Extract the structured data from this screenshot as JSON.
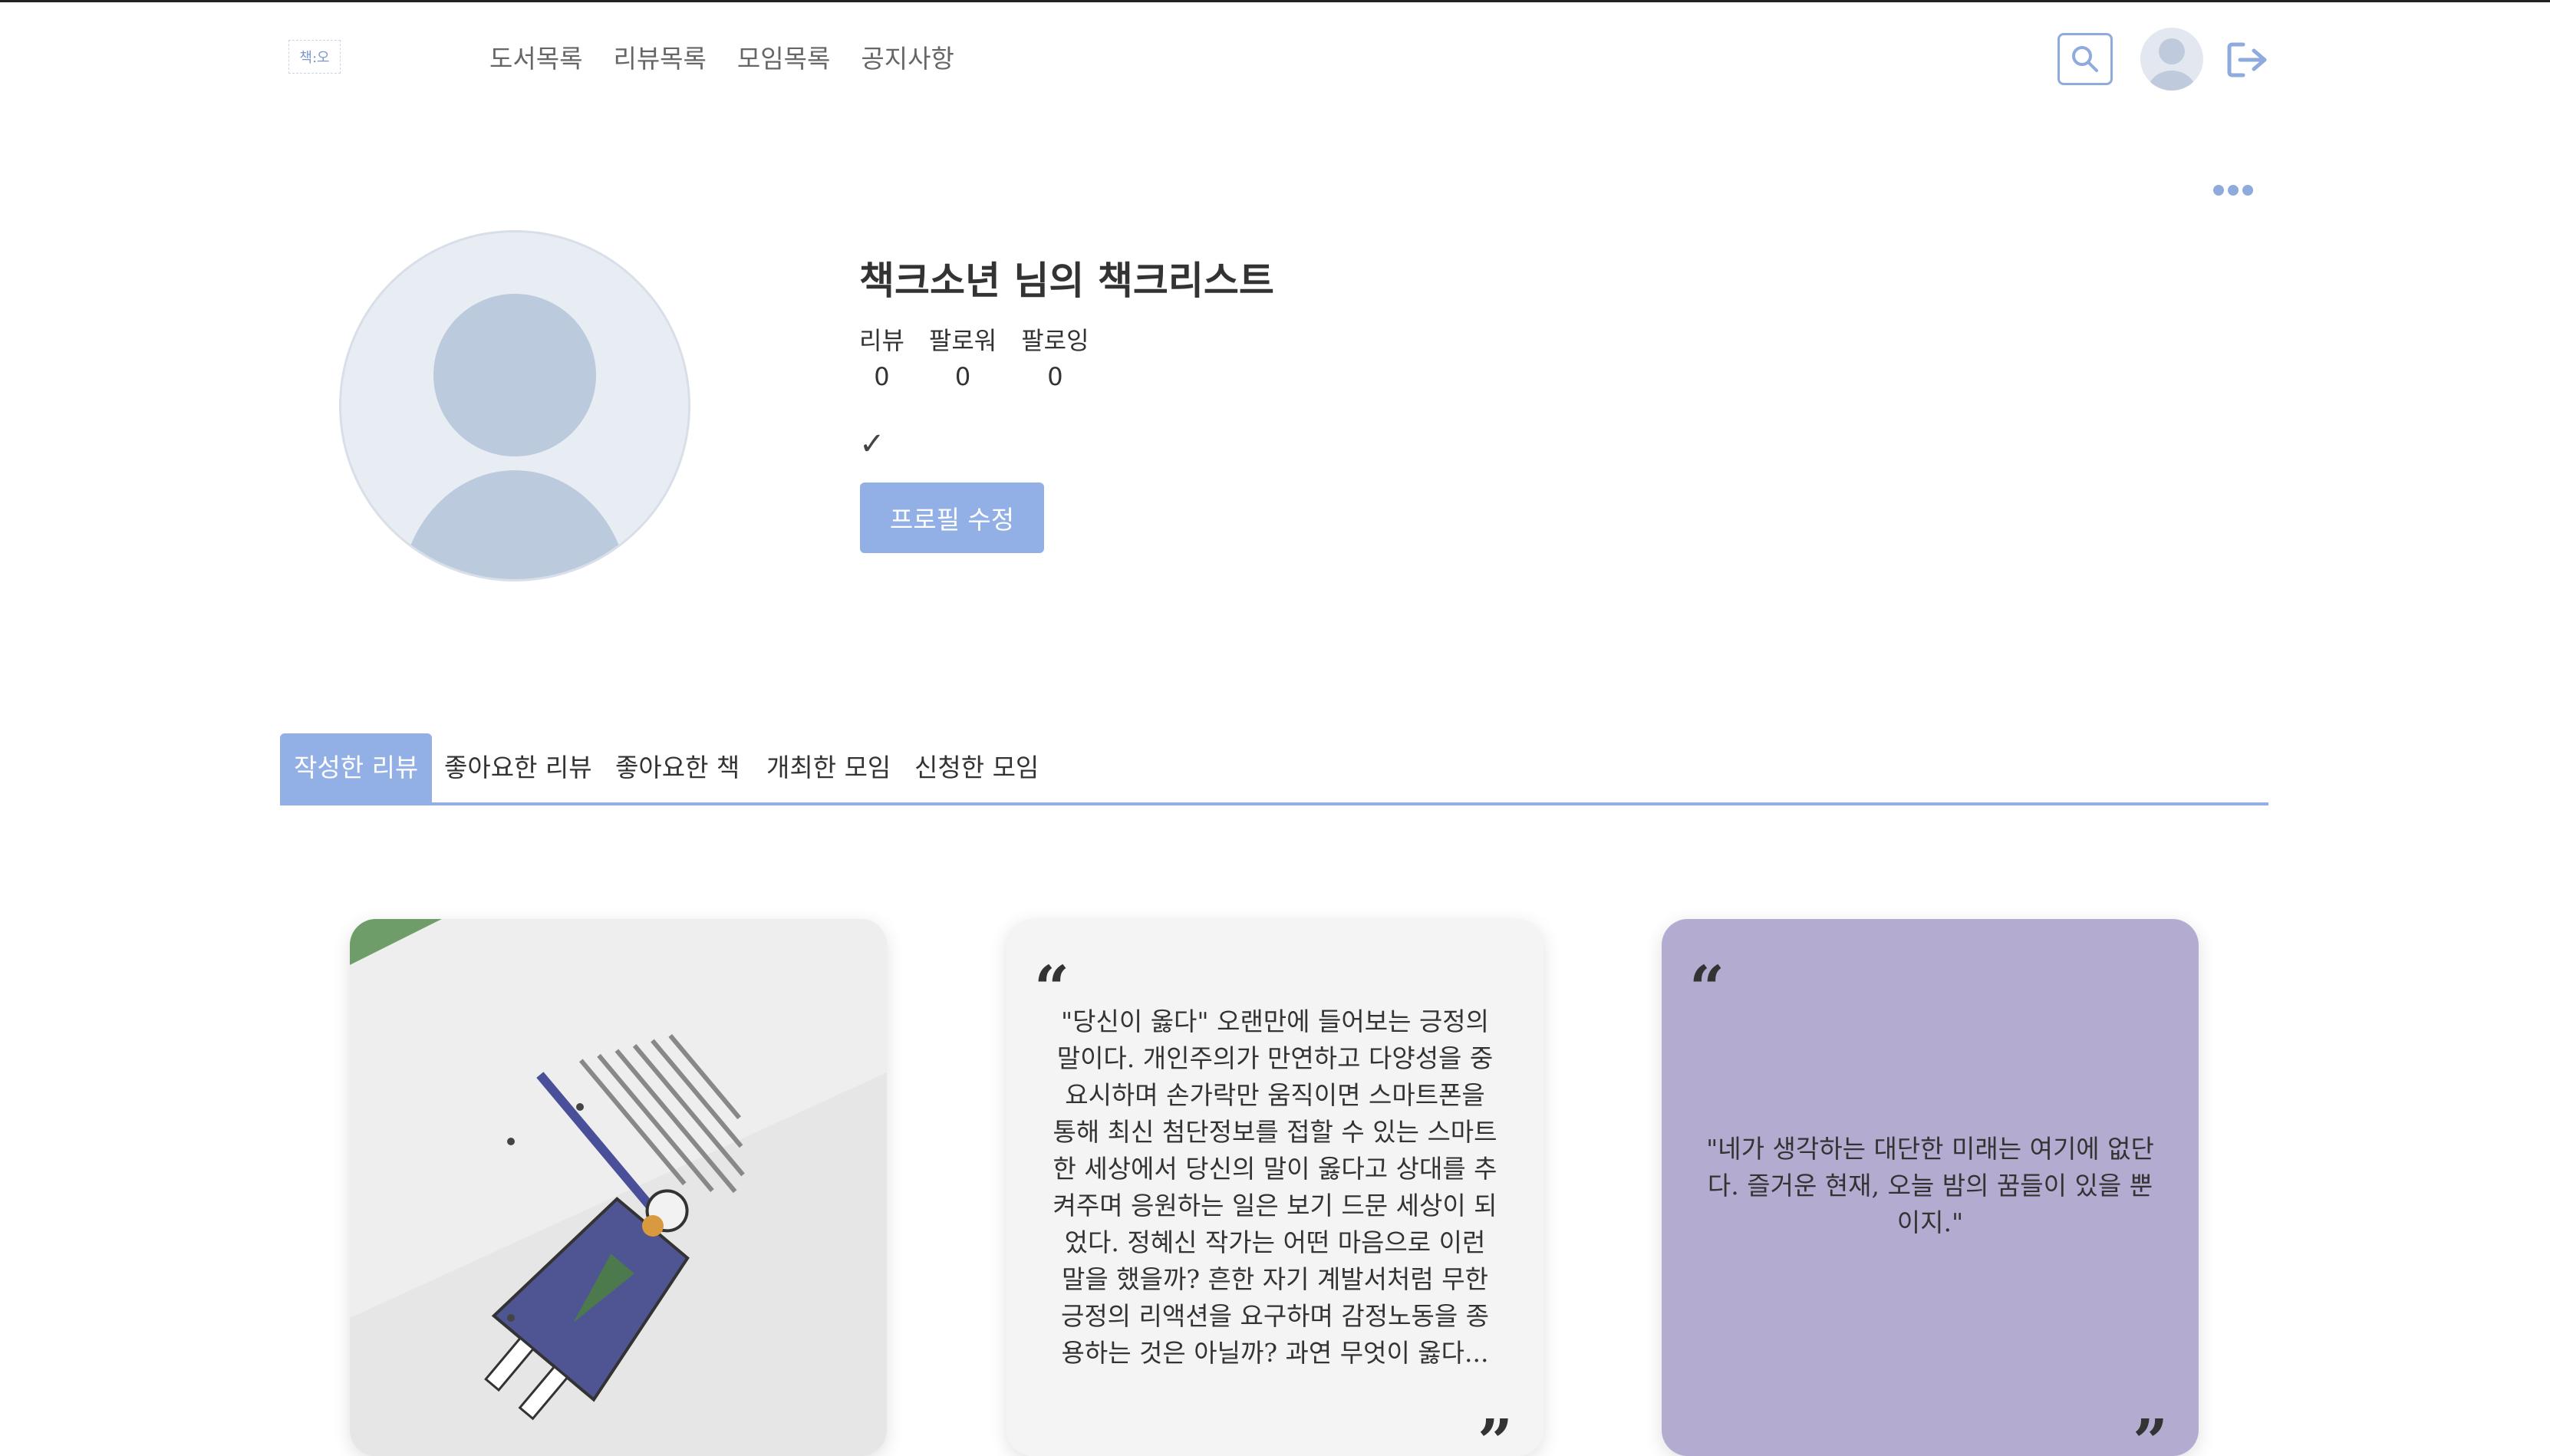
{
  "header": {
    "logo_text": "책:오",
    "nav": [
      "도서목록",
      "리뷰목록",
      "모임목록",
      "공지사항"
    ]
  },
  "profile": {
    "title": "책크소년 님의 책크리스트",
    "stats": [
      {
        "label": "리뷰",
        "value": "0"
      },
      {
        "label": "팔로워",
        "value": "0"
      },
      {
        "label": "팔로잉",
        "value": "0"
      }
    ],
    "check": "✓",
    "edit_button": "프로필 수정"
  },
  "tabs": [
    "작성한 리뷰",
    "좋아요한 리뷰",
    "좋아요한 책",
    "개최한 모임",
    "신청한 모임"
  ],
  "active_tab": "작성한 리뷰",
  "cards": [
    {
      "type": "image"
    },
    {
      "type": "quote",
      "text": "\"당신이 옳다\" 오랜만에 들어보는 긍정의 말이다. 개인주의가 만연하고 다양성을 중요시하며 손가락만 움직이면 스마트폰을 통해 최신 첨단정보를 접할 수 있는 스마트한 세상에서 당신의 말이 옳다고 상대를 추켜주며 응원하는 일은 보기 드문 세상이 되었다. 정혜신 작가는 어떤 마음으로 이런 말을 했을까? 흔한 자기 계발서처럼 무한 긍정의 리액션을 요구하며 감정노동을 종용하는 것은 아닐까? 과연 무엇이 옳다..."
    },
    {
      "type": "quote",
      "text": "\"네가 생각하는 대단한 미래는 여기에 없단다. 즐거운 현재, 오늘 밤의 꿈들이 있을 뿐이지.\""
    }
  ],
  "colors": {
    "accent": "#93b0e6",
    "card3_bg": "#b4acd0"
  }
}
